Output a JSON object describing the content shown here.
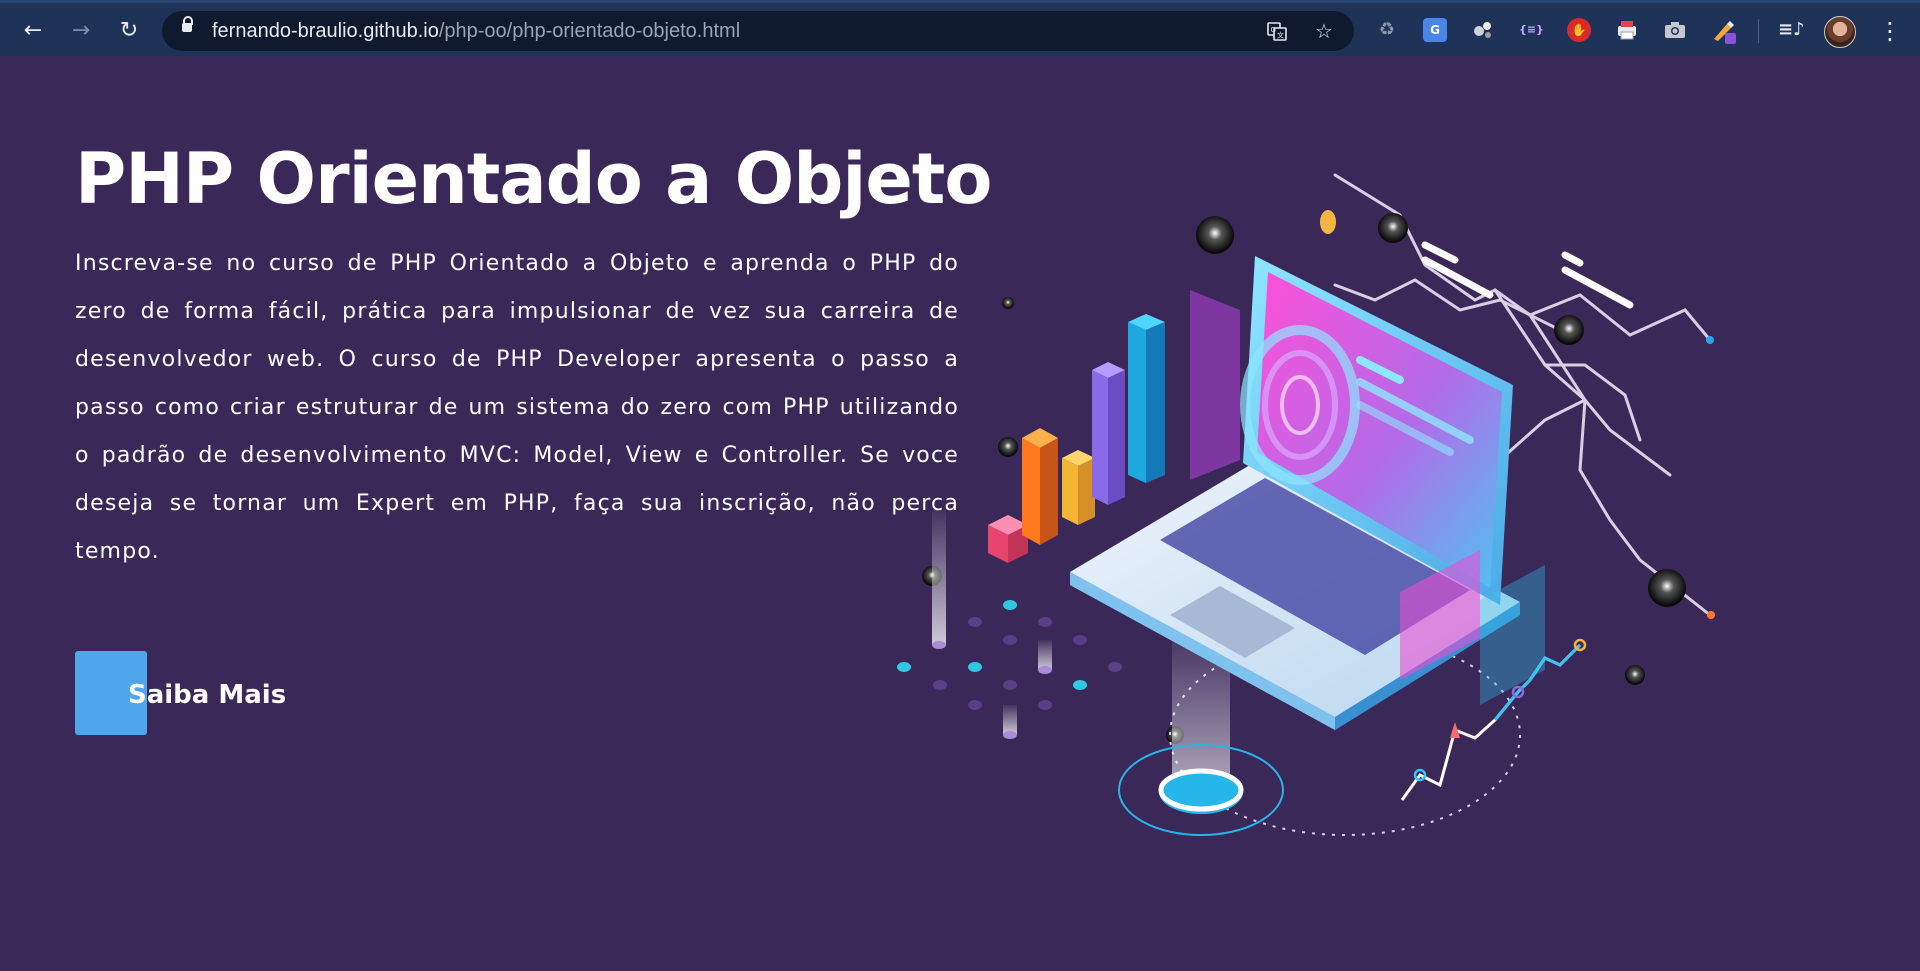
{
  "browser": {
    "url_host": "fernando-braulio.github.io",
    "url_path": "/php-oo/php-orientado-objeto.html",
    "icons": [
      "back-icon",
      "forward-icon",
      "reload-icon",
      "lock-icon",
      "translate-icon",
      "bookmark-star-icon",
      "menu-icon"
    ],
    "extensions": [
      "recycle-extension-icon",
      "google-translate-extension-icon",
      "molecule-extension-icon",
      "json-extension-icon",
      "adblock-extension-icon",
      "print-extension-icon",
      "camera-extension-icon",
      "color-picker-extension-icon",
      "media-control-icon"
    ]
  },
  "hero": {
    "title": "PHP Orientado a Objeto",
    "description": "Inscreva-se no curso de PHP Orientado a Objeto e aprenda o PHP do zero de forma fácil, prática para impulsionar de vez sua carreira de desenvolvedor web. O curso de PHP Developer apresenta o passo a passo como criar estruturar de um sistema do zero com PHP utilizando o padrão de desenvolvimento MVC: Model, View e Controller. Se voce deseja se tornar um Expert em PHP, faça sua inscrição, não perca tempo.",
    "button_label": "Saiba Mais"
  },
  "colors": {
    "background": "#3a2859",
    "button": "#4ea7ea",
    "chrome": "#1f3359",
    "accent_pink": "#e84fd6",
    "accent_cyan": "#34c6f0"
  },
  "illustration": {
    "name": "isometric-laptop-illustration"
  }
}
